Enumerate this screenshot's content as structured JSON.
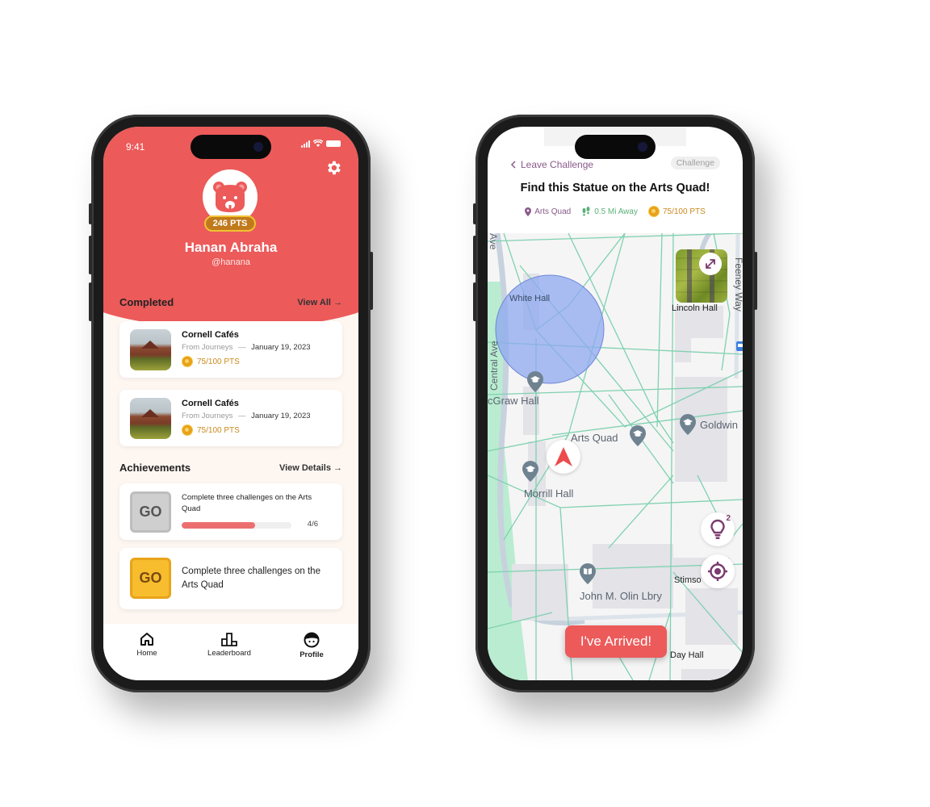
{
  "profile_screen": {
    "status_bar": {
      "time": "9:41"
    },
    "user": {
      "points_badge": "246 PTS",
      "name": "Hanan Abraha",
      "handle": "@hanana"
    },
    "completed": {
      "title": "Completed",
      "link": "View All →",
      "items": [
        {
          "title": "Cornell Cafés",
          "source": "From Journeys",
          "separator": "—",
          "date": "January 19, 2023",
          "points": "75/100 PTS"
        },
        {
          "title": "Cornell Cafés",
          "source": "From Journeys",
          "separator": "—",
          "date": "January 19, 2023",
          "points": "75/100 PTS"
        }
      ]
    },
    "achievements": {
      "title": "Achievements",
      "link": "View Details →",
      "items": [
        {
          "badge_text": "GO",
          "text": "Complete three challenges on the Arts Quad",
          "progress": 0.667,
          "count": "4/6",
          "state": "locked"
        },
        {
          "badge_text": "GO",
          "text": "Complete three challenges on the Arts Quad",
          "state": "earned"
        }
      ]
    },
    "tabbar": [
      {
        "label": "Home",
        "icon": "home-icon",
        "active": false
      },
      {
        "label": "Leaderboard",
        "icon": "leaderboard-icon",
        "active": false
      },
      {
        "label": "Profile",
        "icon": "profile-icon",
        "active": true
      }
    ]
  },
  "challenge_screen": {
    "back_label": "Leave Challenge",
    "chip": "Challenge",
    "title": "Find this Statue on the Arts Quad!",
    "meta": {
      "location": "Arts Quad",
      "distance": "0.5 Mi Away",
      "points": "75/100 PTS"
    },
    "map": {
      "labels": {
        "white_hall": "White Hall",
        "lincoln_hall": "Lincoln Hall",
        "central_ave": "Central Ave",
        "ave_top": "Ave",
        "mcgraw_hall": "cGraw Hall",
        "arts_quad": "Arts Quad",
        "goldwin": "Goldwin",
        "morrill_hall": "Morrill Hall",
        "stimson": "Stimso",
        "olin_library": "John M. Olin Lbry",
        "day_hall": "Day Hall",
        "feeney_way": "Feeney Way"
      },
      "hint_count": "2"
    },
    "arrived_button": "I've Arrived!"
  },
  "colors": {
    "brand_red": "#ec5a5a",
    "cream_bg": "#fdf6f1",
    "gold": "#c98a1e",
    "purple": "#7a3b6e",
    "path_green": "#7fd1b0",
    "radius_blue": "#8ea8f0"
  }
}
